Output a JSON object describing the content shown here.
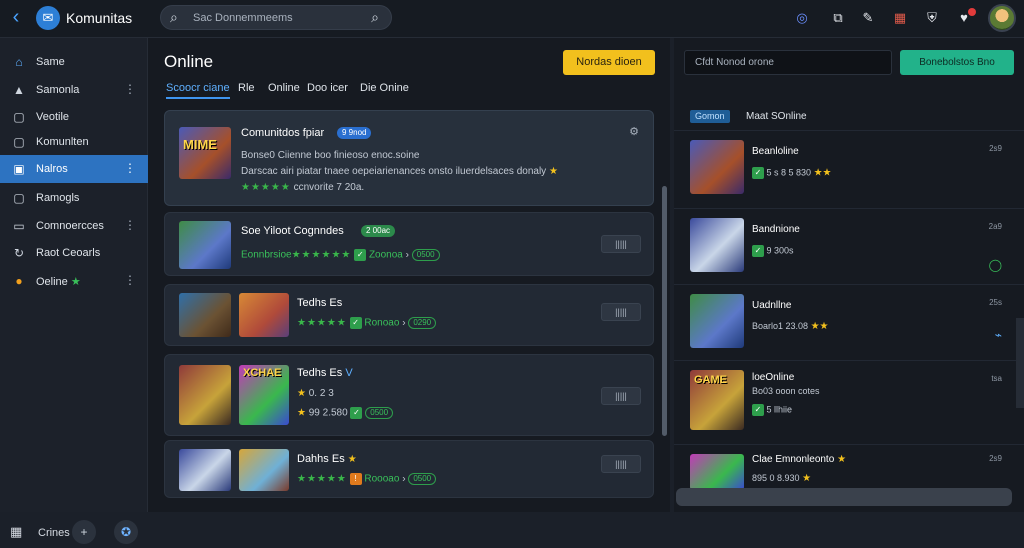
{
  "app": {
    "title": "Komunitas"
  },
  "topbar": {
    "search_placeholder": "Sac Donnemmeems",
    "icons": [
      "search-icon",
      "copy-icon",
      "edit-icon",
      "calendar-icon",
      "shield-icon",
      "heart-icon"
    ]
  },
  "sidebar": {
    "items": [
      {
        "label": "Same",
        "icon": "home-icon"
      },
      {
        "label": "Samonla",
        "icon": "house-icon",
        "more": "⋮"
      },
      {
        "label": "Veotile",
        "icon": "square-icon"
      },
      {
        "label": "Komunlten",
        "icon": "square-icon"
      },
      {
        "label": "Nalros",
        "icon": "square-icon",
        "more": "⋮"
      },
      {
        "label": "Ramogls",
        "icon": "square-icon"
      },
      {
        "label": "Comnoercces",
        "icon": "square-icon",
        "more": "⋮"
      },
      {
        "label": "Raot Ceoarls",
        "icon": "refresh-icon"
      },
      {
        "label": "Oeline",
        "icon": "circle-icon",
        "more": "⋮"
      }
    ],
    "bottom_label": "Crines"
  },
  "main": {
    "title": "Online",
    "yellow_button": "Nordas dioen",
    "tabs": [
      "Scoocr ciane",
      "Rle",
      "Online",
      "Doo icer",
      "Die Onine"
    ],
    "cards": [
      {
        "title": "Comunitdos fpiar",
        "tag": "9 9nod",
        "line1": "Bonse0 Ciienne boo finieoso enoc.soine",
        "line2": "Darscac airi piatar tnaee oepeiarienances onsto iluerdelsaces donaly",
        "line3": "ccnvorite 7 20a."
      },
      {
        "title": "Soe Yiloot Cognndes",
        "tag": "2 00ac",
        "line1": "Eonnbrsioe",
        "line1b": "Zoonoa",
        "line1c": "0500",
        "button": "|||||"
      },
      {
        "title": "Tedhs Es",
        "tag": "9",
        "line1": "Ronoao",
        "line1b": "0290",
        "button": "|||||"
      },
      {
        "title": "Tedhs Es",
        "tag": "V",
        "line1": "0. 2 3",
        "line2": "99 2.580",
        "line2b": "0500",
        "button": "|||||"
      },
      {
        "title": "Dahhs Es",
        "tag": "★",
        "line1": "Roooao",
        "line1b": "0500",
        "button": "|||||"
      }
    ],
    "thumb_labels": [
      "MIME",
      "XCHAE"
    ]
  },
  "right": {
    "input_placeholder": "Cfdt Nonod orone",
    "green_button": "Bonebolstos  Bno",
    "badge": "Gomon",
    "heading": "Maat SOnline",
    "items": [
      {
        "name": "Beanloline",
        "sub": "5 s 8 5 830",
        "x": "2s9"
      },
      {
        "name": "Bandnione",
        "sub": "9 300s",
        "x": "2a9"
      },
      {
        "name": "Uadnllne",
        "sub": "Boarlo1 23.08",
        "x": "25s"
      },
      {
        "name": "loeOnline",
        "sub": "Bo03 ooon cotes",
        "sub2": "5 llhiie",
        "x": "tsa"
      },
      {
        "name": "Clae Emnonleonto",
        "sub": "895 0 8.930",
        "x": "2s9"
      }
    ],
    "thumb_label": "GAME"
  }
}
